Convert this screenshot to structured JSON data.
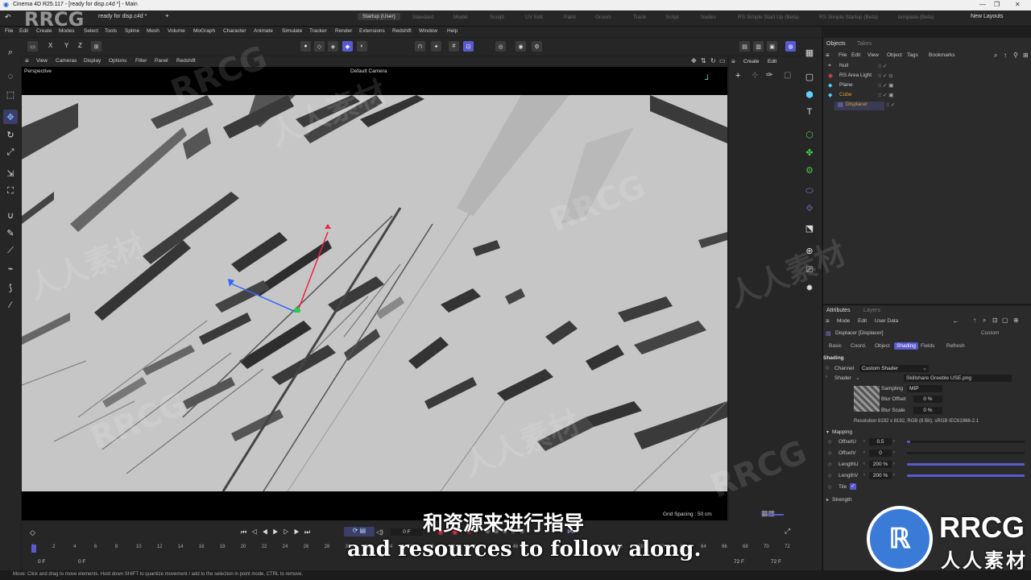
{
  "window": {
    "title": "Cinema 4D R25.117 - [ready for disp.c4d *] - Main",
    "controls": [
      "—",
      "❐",
      "✕"
    ]
  },
  "doc_tabs": {
    "active": "ready for disp.c4d *",
    "new_tab": "+"
  },
  "layouts": {
    "items": [
      "Startup (User)",
      "Standard",
      "Model",
      "Sculpt",
      "UV Edit",
      "Paint",
      "Groom",
      "Track",
      "Script",
      "Nodes",
      "RS Simple Start Up (Beta)",
      "RS Simple Startup (Beta)",
      "template (Beta)"
    ],
    "active_index": 0,
    "new_layouts": "New Layouts"
  },
  "menu": [
    "File",
    "Edit",
    "Create",
    "Modes",
    "Select",
    "Tools",
    "Spline",
    "Mesh",
    "Volume",
    "MoGraph",
    "Character",
    "Animate",
    "Simulate",
    "Tracker",
    "Render",
    "Extensions",
    "Redshift",
    "Window",
    "Help"
  ],
  "toolbar": {
    "axis": [
      "X",
      "Y",
      "Z"
    ]
  },
  "viewport": {
    "menu": [
      "View",
      "Cameras",
      "Display",
      "Options",
      "Filter",
      "Panel",
      "Redshift"
    ],
    "label": "Perspective",
    "camera": "Default Camera",
    "grid_spacing": "Grid Spacing : 50 cm"
  },
  "side_panel": {
    "menu": [
      "Create",
      "Edit"
    ]
  },
  "objects": {
    "tabs": [
      "Objects",
      "Takes"
    ],
    "menu": [
      "File",
      "Edit",
      "View",
      "Object",
      "Tags",
      "Bookmarks"
    ],
    "rows": [
      {
        "name": "Null"
      },
      {
        "name": "RS Area Light"
      },
      {
        "name": "Plane"
      },
      {
        "name": "Cube"
      },
      {
        "name": "Displacer"
      }
    ]
  },
  "attributes": {
    "tabs": [
      "Attributes",
      "Layers"
    ],
    "menu": [
      "Mode",
      "Edit",
      "User Data"
    ],
    "object": "Displacer [Displacer]",
    "preset": "Custom",
    "subtabs": [
      "Basic",
      "Coord.",
      "Object",
      "Shading",
      "Fields",
      "Refresh"
    ],
    "active_subtab": 3,
    "shading": {
      "heading": "Shading",
      "channel_label": "Channel",
      "channel_value": "Custom Shader",
      "shader_label": "Shader",
      "shader_file": "Skillshare Greeble USE.png",
      "sampling_label": "Sampling",
      "sampling_value": "MIP",
      "blur_offset_label": "Blur Offset",
      "blur_offset_value": "0 %",
      "blur_scale_label": "Blur Scale",
      "blur_scale_value": "0 %",
      "resolution": "Resolution 8192 x 8192, RGB (8 Bit), sRGB IEC61966-2.1"
    },
    "mapping": {
      "heading": "Mapping",
      "rows": [
        {
          "label": "OffsetU",
          "value": "0.5",
          "fill": 0.03
        },
        {
          "label": "OffsetV",
          "value": "0",
          "fill": 0
        },
        {
          "label": "LengthU",
          "value": "200 %",
          "fill": 1
        },
        {
          "label": "LengthV",
          "value": "200 %",
          "fill": 1
        }
      ],
      "tile_label": "Tile"
    },
    "strength": "Strength"
  },
  "timeline": {
    "frame_field": "0 F",
    "start": "0 F",
    "start2": "0 F",
    "end": "72 F",
    "end2": "72 F",
    "ticks": [
      "0",
      "2",
      "4",
      "6",
      "8",
      "10",
      "12",
      "14",
      "16",
      "18",
      "20",
      "22",
      "24",
      "26",
      "28",
      "30",
      "32",
      "34",
      "36",
      "38",
      "40",
      "42",
      "44",
      "46",
      "48",
      "50",
      "52",
      "54",
      "56",
      "58",
      "60",
      "62",
      "64",
      "66",
      "68",
      "70",
      "72"
    ]
  },
  "status": "Move: Click and drag to move elements. Hold down SHIFT to quantize movement / add to the selection in point mode, CTRL to remove.",
  "subtitles": {
    "zh": "和资源来进行指导",
    "en": "and resources to follow along."
  },
  "watermark": {
    "brand": "RRCG",
    "cn": "人人素材"
  },
  "colors": {
    "accent": "#5a5ad0",
    "cyan": "#5fd0ff",
    "brand_blue": "#3b7bd8"
  }
}
